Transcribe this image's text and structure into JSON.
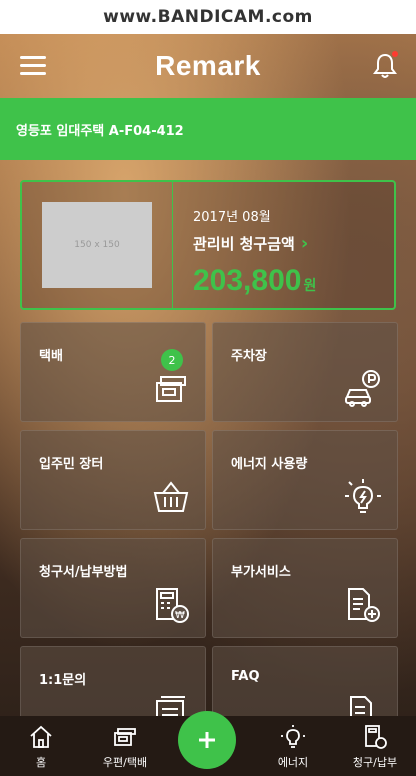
{
  "watermark": "www.BANDICAM.com",
  "header": {
    "logo": "Remark"
  },
  "address": {
    "text": "영등포 임대주택 A-F04-412"
  },
  "bill": {
    "image_placeholder": "150 x 150",
    "month": "2017년 08월",
    "title": "관리비 청구금액",
    "amount": "203,800",
    "currency": "원"
  },
  "tiles": [
    {
      "label": "택배",
      "badge": "2",
      "icon": "parcel-icon"
    },
    {
      "label": "주차장",
      "icon": "parking-car-icon"
    },
    {
      "label": "입주민 장터",
      "icon": "basket-icon"
    },
    {
      "label": "에너지 사용량",
      "icon": "lightbulb-icon"
    },
    {
      "label": "청구서/납부방법",
      "icon": "bill-calculator-icon"
    },
    {
      "label": "부가서비스",
      "icon": "document-add-icon"
    },
    {
      "label": "1:1문의",
      "icon": "inquiry-icon"
    },
    {
      "label": "FAQ",
      "icon": "faq-document-icon"
    }
  ],
  "tabbar": {
    "home": "홈",
    "mail": "우편/택배",
    "energy": "에너지",
    "billing": "청구/납부"
  },
  "colors": {
    "accent": "#3fc24a",
    "notification": "#ff3b30"
  }
}
